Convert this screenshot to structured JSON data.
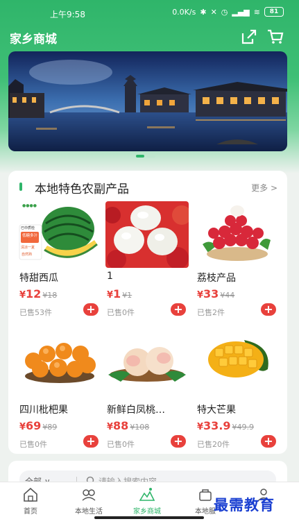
{
  "status_bar": {
    "time": "上午9:58",
    "network_speed": "0.0K/s",
    "battery": "81"
  },
  "header": {
    "title": "家乡商城"
  },
  "banner": {
    "slide_count": 2,
    "active_slide": 1
  },
  "section": {
    "title": "本地特色农副产品",
    "more_label": "更多 >"
  },
  "products": [
    {
      "name": "特甜西瓜",
      "currency": "¥",
      "price": "12",
      "old_price": "¥18",
      "sold": "已售53件",
      "add_label": "+",
      "image": "watermelon",
      "badge_lines": [
        "已中质检",
        "低糖多汁",
        "清凉一夏",
        "自然熟"
      ]
    },
    {
      "name": "1",
      "currency": "¥",
      "price": "1",
      "old_price": "¥1",
      "sold": "已售0件",
      "add_label": "+",
      "image": "lychee-peeled"
    },
    {
      "name": "荔枝产品",
      "currency": "¥",
      "price": "33",
      "old_price": "¥44",
      "sold": "已售2件",
      "add_label": "+",
      "image": "lychee-bowl"
    },
    {
      "name": "四川枇杷果",
      "currency": "¥",
      "price": "69",
      "old_price": "¥89",
      "sold": "已售0件",
      "add_label": "+",
      "image": "loquat"
    },
    {
      "name": "新鲜白凤桃…",
      "currency": "¥",
      "price": "88",
      "old_price": "¥108",
      "sold": "已售0件",
      "add_label": "+",
      "image": "peach"
    },
    {
      "name": "特大芒果",
      "currency": "¥",
      "price": "33.9",
      "old_price": "¥49.9",
      "sold": "已售20件",
      "add_label": "+",
      "image": "mango"
    }
  ],
  "search": {
    "filter_label": "全部 ∨",
    "placeholder": "请输入搜索内容"
  },
  "tabbar": [
    {
      "label": "首页",
      "icon": "home-icon"
    },
    {
      "label": "本地生活",
      "icon": "local-life-icon"
    },
    {
      "label": "家乡商城",
      "icon": "hometown-mall-icon",
      "active": true
    },
    {
      "label": "本地服",
      "icon": "local-service-icon"
    },
    {
      "label": "",
      "icon": "profile-icon"
    }
  ],
  "watermark": "最需教育",
  "colors": {
    "brand_green": "#2fb56a",
    "price_red": "#e8413c"
  }
}
